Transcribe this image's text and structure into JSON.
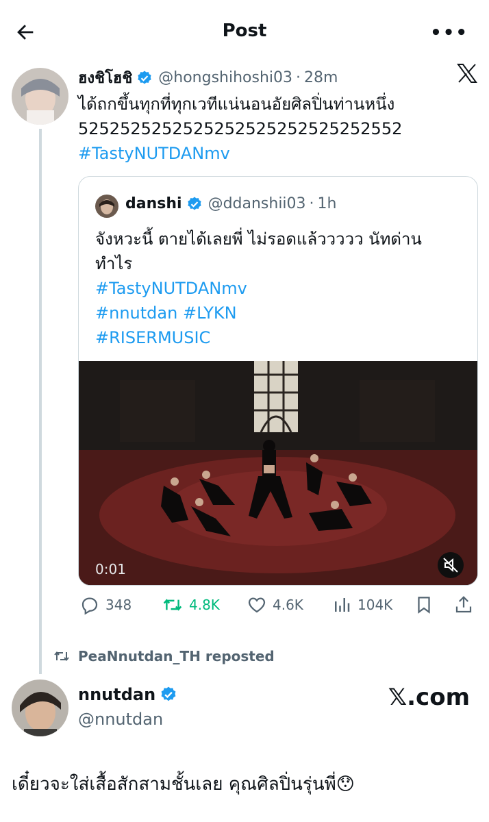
{
  "header": {
    "title": "Post"
  },
  "main_post": {
    "name": "ฮงชิโฮชิ",
    "handle": "@hongshihoshi03",
    "time": "28m",
    "text_line1": "ได้ถกขึ้นทุกที่ทุกเวทีแน่นอนอัยศิลปิ่นท่านหนึ่ง",
    "text_line2": "5252525252525252525252525252552",
    "hashtag": "#TastyNUTDANmv"
  },
  "quoted_post": {
    "name": "danshi",
    "handle": "@ddanshii03",
    "time": "1h",
    "text_line1": "จังหวะนี้ ตายได้เลยพี่ ไม่รอดแล้ววววว นัทด่าน",
    "text_line2": "ทำไร",
    "hashtag1": "#TastyNUTDANmv",
    "hashtag2": "#nnutdan",
    "hashtag3": "#LYKN",
    "hashtag4": "#RISERMUSIC",
    "video_time": "0:01"
  },
  "actions": {
    "replies": "348",
    "reposts": "4.8K",
    "likes": "4.6K",
    "views": "104K"
  },
  "repost_info": {
    "text": "PeaNnutdan_TH reposted"
  },
  "second_post": {
    "name": "nnutdan",
    "handle": "@nnutdan",
    "text": "เดี๋ยวจะใส่เสื้อสักสามชั้นเลย คุณศิลปิ่นรุ่นพี่😯"
  },
  "watermark": "𝕏.com",
  "colors": {
    "accent": "#1d9bf0",
    "repost_green": "#00ba7c",
    "muted": "#536471"
  }
}
